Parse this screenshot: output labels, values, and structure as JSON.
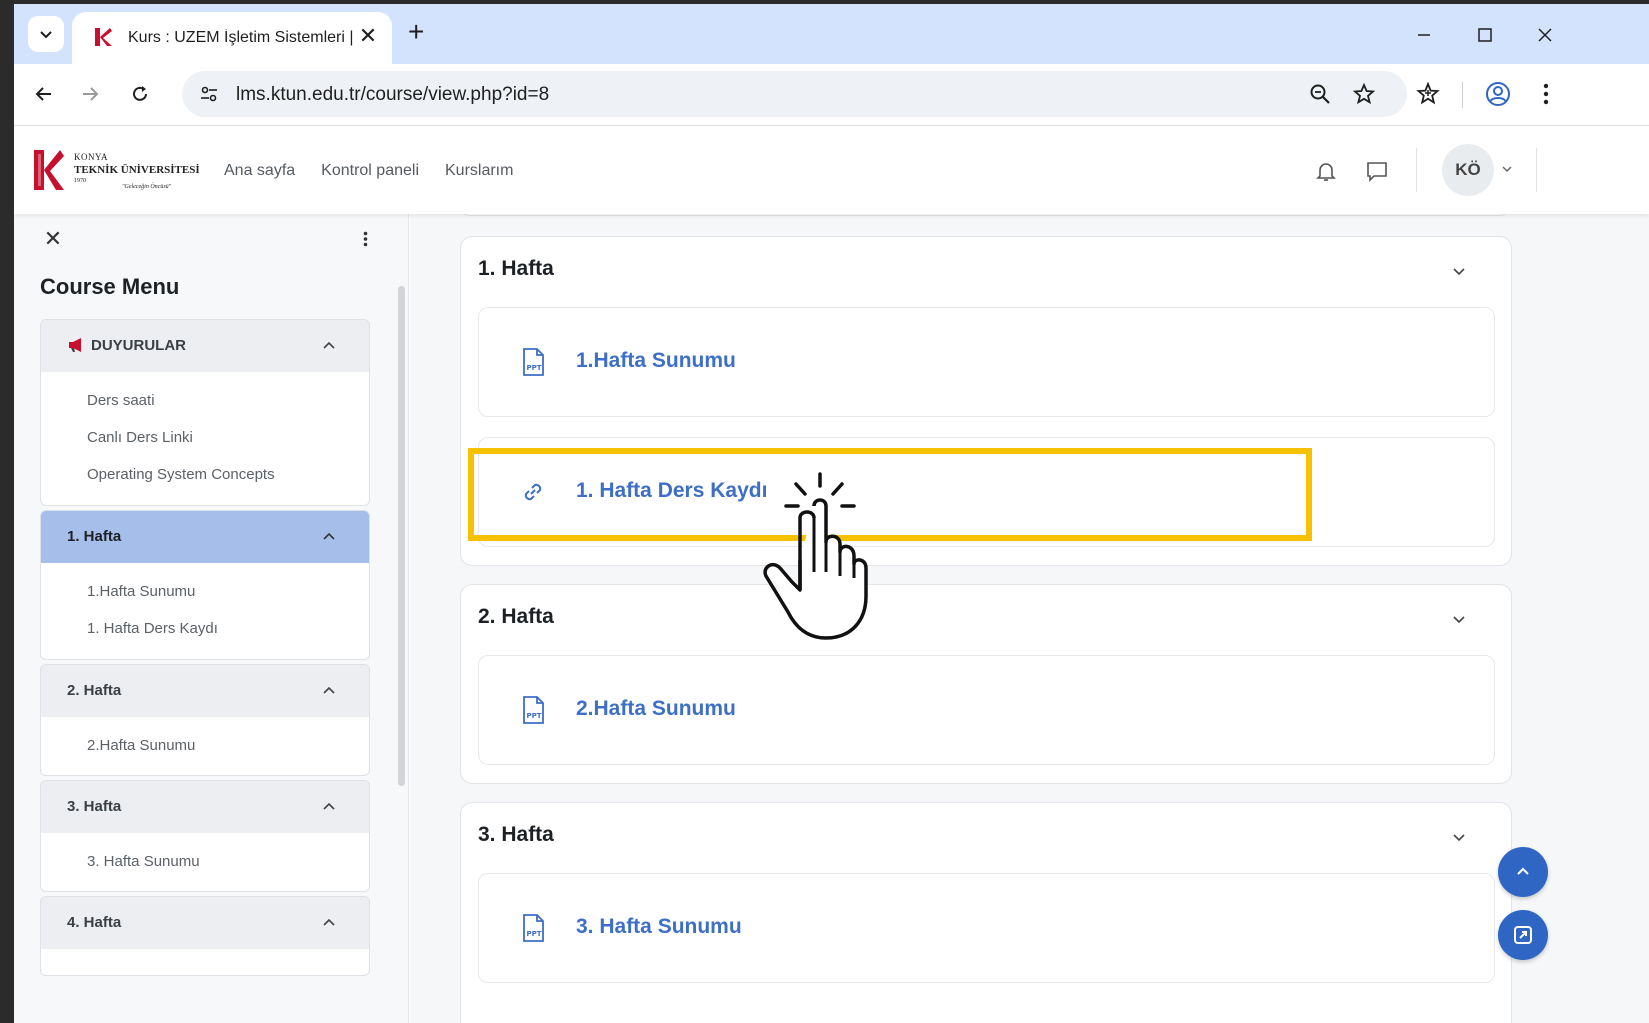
{
  "browser": {
    "tab_title": "Kurs : UZEM İşletim Sistemleri |",
    "url": "lms.ktun.edu.tr/course/view.php?id=8"
  },
  "site": {
    "logo_lines": [
      "KONYA",
      "TEKNİK ÜNİVERSİTESİ",
      "1970",
      "\"Geleceğin Öncüsü\""
    ],
    "nav": [
      "Ana sayfa",
      "Kontrol paneli",
      "Kurslarım"
    ],
    "user_initials": "KÖ"
  },
  "drawer": {
    "title": "Course Menu",
    "sections": [
      {
        "title": "DUYURULAR",
        "items": [
          "Ders saati",
          "Canlı Ders Linki",
          "Operating System Concepts"
        ]
      },
      {
        "title": "1. Hafta",
        "items": [
          "1.Hafta Sunumu",
          "1. Hafta Ders Kaydı"
        ]
      },
      {
        "title": "2. Hafta",
        "items": [
          "2.Hafta Sunumu"
        ]
      },
      {
        "title": "3. Hafta",
        "items": [
          "3. Hafta Sunumu"
        ]
      },
      {
        "title": "4. Hafta",
        "items": []
      }
    ]
  },
  "main": {
    "sections": [
      {
        "title": "1. Hafta",
        "activities": [
          {
            "label": "1.Hafta Sunumu",
            "icon": "ppt-icon"
          },
          {
            "label": "1. Hafta Ders Kaydı",
            "icon": "link-icon"
          }
        ]
      },
      {
        "title": "2. Hafta",
        "activities": [
          {
            "label": "2.Hafta Sunumu",
            "icon": "ppt-icon"
          }
        ]
      },
      {
        "title": "3. Hafta",
        "activities": [
          {
            "label": "3. Hafta Sunumu",
            "icon": "ppt-icon"
          }
        ]
      }
    ]
  },
  "colors": {
    "accent": "#3d6fc6",
    "highlight": "#f6c100",
    "active_section": "#a5bfea",
    "fab": "#2f66c4"
  }
}
